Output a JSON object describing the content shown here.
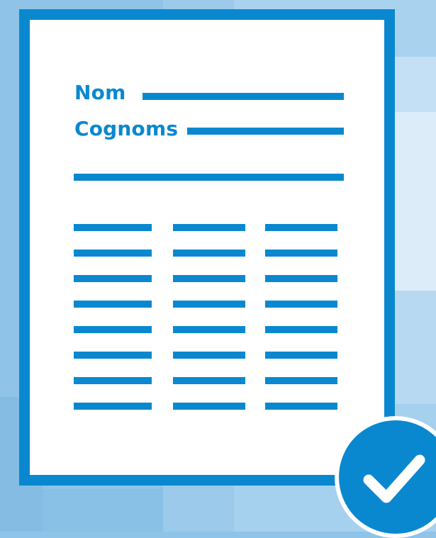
{
  "document": {
    "fields": {
      "name_label": "Nom",
      "surname_label": "Cognoms"
    },
    "table": {
      "columns": 3,
      "rows": 8
    }
  },
  "badge": {
    "icon": "check-icon"
  },
  "colors": {
    "accent": "#0a88cf",
    "paper": "#ffffff",
    "background": "#8fc4e8"
  }
}
